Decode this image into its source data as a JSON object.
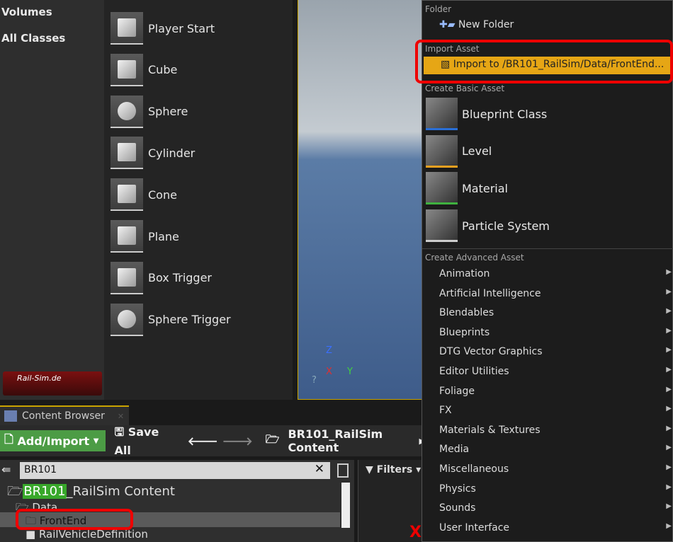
{
  "categories": [
    "Volumes",
    "All Classes"
  ],
  "place_items": [
    {
      "label": "Player Start",
      "icon": "player-start-icon"
    },
    {
      "label": "Cube",
      "icon": "cube-icon"
    },
    {
      "label": "Sphere",
      "icon": "sphere-icon"
    },
    {
      "label": "Cylinder",
      "icon": "cylinder-icon"
    },
    {
      "label": "Cone",
      "icon": "cone-icon"
    },
    {
      "label": "Plane",
      "icon": "plane-icon"
    },
    {
      "label": "Box Trigger",
      "icon": "box-trigger-icon"
    },
    {
      "label": "Sphere Trigger",
      "icon": "sphere-trigger-icon"
    }
  ],
  "logo": "Rail-Sim.de",
  "viewport": {
    "axis_z": "Z",
    "axis_x": "X",
    "axis_y": "Y"
  },
  "content_browser": {
    "tab": "Content Browser",
    "add_import": "Add/Import",
    "save_all": "Save All",
    "path": "BR101_RailSim Content",
    "search_value": "BR101",
    "filters": "Filters",
    "tree": [
      {
        "match": "BR101",
        "rest": "_RailSim Content"
      },
      {
        "label": "Data"
      },
      {
        "label": "FrontEnd"
      },
      {
        "label": "RailVehicleDefinition"
      }
    ]
  },
  "menu": {
    "folder_header": "Folder",
    "new_folder": "New Folder",
    "import_header": "Import Asset",
    "import_item": "Import to /BR101_RailSim/Data/FrontEnd...",
    "basic_header": "Create Basic Asset",
    "basic": [
      {
        "label": "Blueprint Class",
        "color": "#2a6fd6"
      },
      {
        "label": "Level",
        "color": "#e8a020"
      },
      {
        "label": "Material",
        "color": "#3fb13f"
      },
      {
        "label": "Particle System",
        "color": "#cccccc"
      }
    ],
    "advanced_header": "Create Advanced Asset",
    "advanced": [
      "Animation",
      "Artificial Intelligence",
      "Blendables",
      "Blueprints",
      "DTG Vector Graphics",
      "Editor Utilities",
      "Foliage",
      "FX",
      "Materials & Textures",
      "Media",
      "Miscellaneous",
      "Physics",
      "Sounds",
      "User Interface"
    ]
  },
  "colors": {
    "highlight": "#e6a615",
    "annotation": "#e00000"
  }
}
